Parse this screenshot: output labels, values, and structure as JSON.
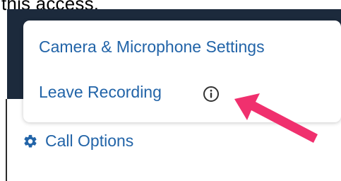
{
  "top_text": "this access.",
  "menu": {
    "items": [
      {
        "label": "Camera & Microphone Settings"
      },
      {
        "label": "Leave Recording"
      }
    ],
    "info_icon": "info-circle-icon"
  },
  "call_options": {
    "label": "Call Options",
    "icon": "gear-icon"
  },
  "colors": {
    "link": "#2264a8",
    "dark_panel": "#1c2a3c",
    "arrow": "#f0306e"
  }
}
